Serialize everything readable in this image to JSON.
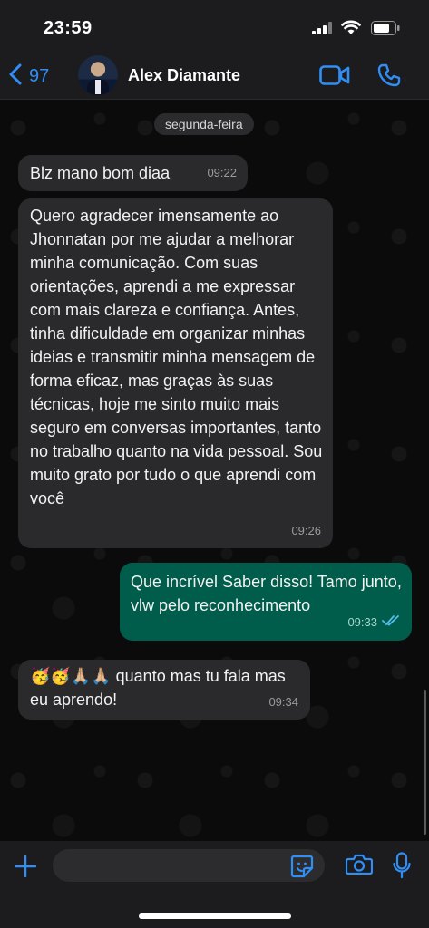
{
  "status_bar": {
    "time": "23:59"
  },
  "header": {
    "back_count": "97",
    "contact_name": "Alex Diamante"
  },
  "chat": {
    "day_label": "segunda-feira",
    "messages": [
      {
        "direction": "incoming",
        "text": "Blz mano bom diaa",
        "time": "09:22"
      },
      {
        "direction": "incoming",
        "text": "Quero agradecer imensamente ao Jhonnatan por me ajudar a melhorar minha comunicação. Com suas orientações, aprendi a me expressar com mais clareza e confiança. Antes, tinha dificuldade em organizar minhas ideias e transmitir minha mensagem de forma eficaz, mas graças às suas técnicas, hoje me sinto muito mais seguro em conversas importantes, tanto no trabalho quanto na vida pessoal. Sou muito grato por tudo o que aprendi com você",
        "time": "09:26"
      },
      {
        "direction": "outgoing",
        "text": "Que incrível Saber disso! Tamo junto, vlw pelo reconhecimento",
        "time": "09:33",
        "status": "read"
      },
      {
        "direction": "incoming",
        "text": "🥳🥳🙏🏼🙏🏼 quanto mas tu fala mas eu aprendo!",
        "time": "09:34"
      }
    ]
  },
  "input": {
    "placeholder": ""
  },
  "colors": {
    "accent": "#2f8ff7",
    "incoming_bubble": "#2a2a2c",
    "outgoing_bubble": "#005c4b",
    "background": "#0b0b0b"
  }
}
